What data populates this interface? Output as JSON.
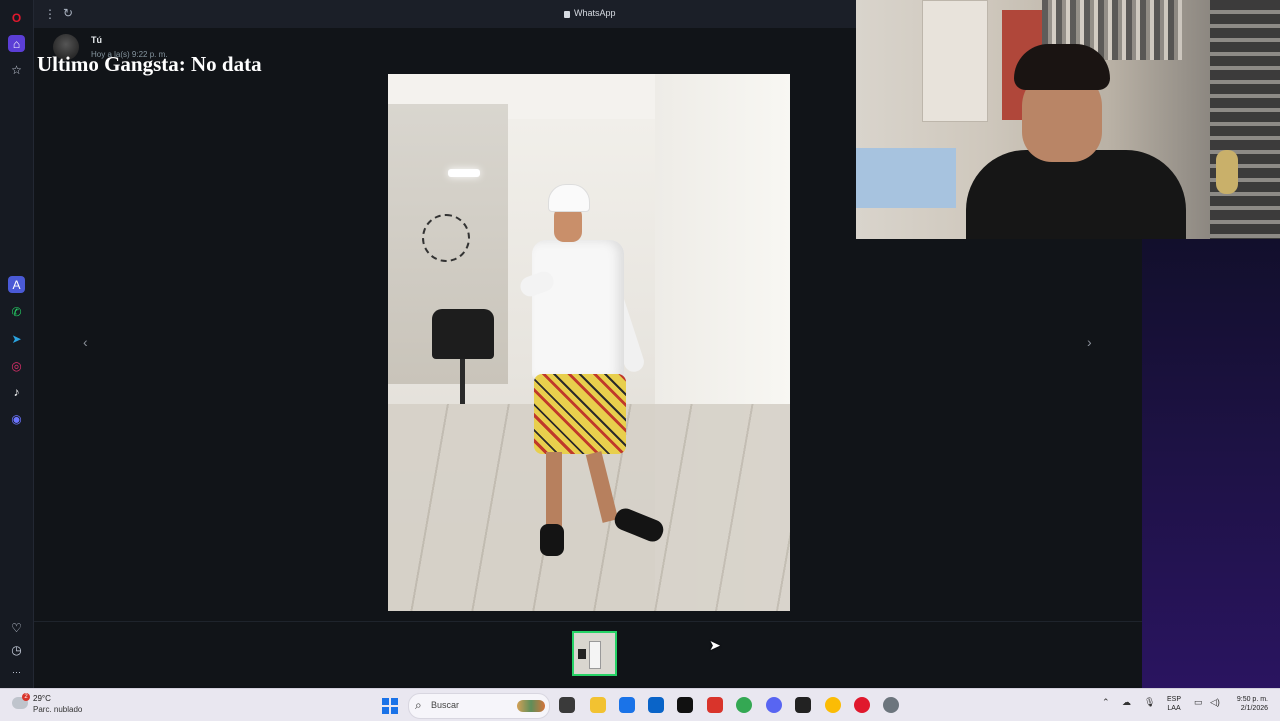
{
  "browser": {
    "tab_title": "WhatsApp",
    "menu_glyph": "⋮",
    "reload_glyph": "↻"
  },
  "sidebar": {
    "items": [
      {
        "name": "opera-logo-icon",
        "glyph": "O",
        "color": "#e0182d"
      },
      {
        "name": "home-icon",
        "glyph": "⌂",
        "color": "#7c5cff"
      },
      {
        "name": "bookmarks-icon",
        "glyph": "☆",
        "color": "#cfd6e4"
      },
      {
        "name": "aria-icon",
        "glyph": "A",
        "color": "#6c8cff"
      },
      {
        "name": "whatsapp-icon",
        "glyph": "✆",
        "color": "#25d366"
      },
      {
        "name": "telegram-icon",
        "glyph": "➤",
        "color": "#2aa3e0"
      },
      {
        "name": "instagram-icon",
        "glyph": "◎",
        "color": "#e1306c"
      },
      {
        "name": "tiktok-icon",
        "glyph": "♪",
        "color": "#ffffff"
      },
      {
        "name": "discord-icon",
        "glyph": "◉",
        "color": "#6b74ff"
      },
      {
        "name": "heart-icon",
        "glyph": "♡",
        "color": "#cfd6e4"
      },
      {
        "name": "history-icon",
        "glyph": "◷",
        "color": "#cfd6e4"
      },
      {
        "name": "more-icon",
        "glyph": "···",
        "color": "#cfd6e4"
      }
    ]
  },
  "viewer": {
    "sender_name": "Tú",
    "sender_time": "Hoy a la(s) 9:22 p. m.",
    "overlay_text": "Ultimo Gangsta: No data",
    "prev_glyph": "‹",
    "next_glyph": "›",
    "accent": "#25d366"
  },
  "taskbar": {
    "weather_temp": "29°C",
    "weather_desc": "Parc. nublado",
    "weather_badge": "2",
    "search_placeholder": "Buscar",
    "lang_line1": "ESP",
    "lang_line2": "LAA",
    "time": "9:50 p. m.",
    "date": "2/1/2026",
    "apps": [
      {
        "name": "task-view-icon",
        "color": "#3a3a3a"
      },
      {
        "name": "file-explorer-icon",
        "color": "#f2c231"
      },
      {
        "name": "store-icon",
        "color": "#1a73e8"
      },
      {
        "name": "outlook-icon",
        "color": "#0a64c8"
      },
      {
        "name": "tiktok-taskbar-icon",
        "color": "#111111"
      },
      {
        "name": "wps-icon",
        "color": "#d9342b"
      },
      {
        "name": "chrome-icon",
        "color": "#34a853"
      },
      {
        "name": "discord-taskbar-icon",
        "color": "#5865f2"
      },
      {
        "name": "capcut-icon",
        "color": "#222222"
      },
      {
        "name": "chrome-profile-icon",
        "color": "#fbbc05"
      },
      {
        "name": "opera-taskbar-icon",
        "color": "#e0182d"
      },
      {
        "name": "settings-icon",
        "color": "#6c757d"
      }
    ]
  }
}
